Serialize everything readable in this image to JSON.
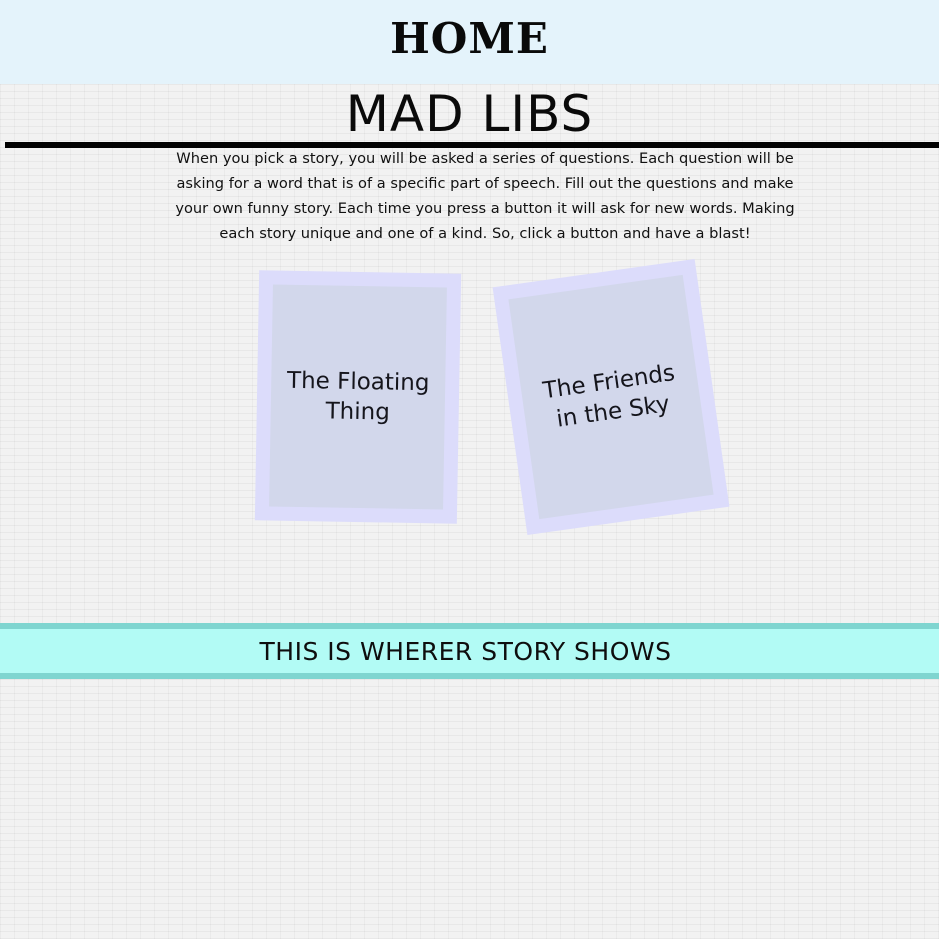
{
  "nav": {
    "home_label": "HOME"
  },
  "page": {
    "title": "MAD LIBS",
    "intro": "When you pick a story, you will be asked a series of questions. Each question will be asking for a word that is of a specific part of speech. Fill out the questions and make your own funny story. Each time you press a button it will ask for new words. Making each story unique and one of a kind. So, click a button and have a blast!"
  },
  "stories": [
    {
      "label": "The Floating Thing"
    },
    {
      "label": "The Friends in the Sky"
    }
  ],
  "story_output": {
    "text": "THIS IS WHERER STORY SHOWS"
  },
  "colors": {
    "topbar_bg": "#e4f3fb",
    "card_frame": "#dcdcfb",
    "card_inner": "#d2d7eb",
    "story_band_bg": "#b2fbf5",
    "story_band_border": "#7fd5d0"
  }
}
